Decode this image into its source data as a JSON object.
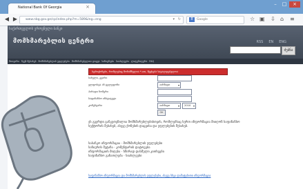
{
  "browser": {
    "tab_title": "National Bank Of Georgia",
    "tab_close": "×",
    "address": "www.nbg.gov.ge/cp/index.php?m=589&lng=eng",
    "search_placeholder": "Google",
    "icons": [
      "back-icon",
      "forward-icon",
      "refresh-icon",
      "star-icon",
      "bookmark-icon",
      "download-icon",
      "home-icon",
      "menu-icon"
    ],
    "window_controls": [
      "–",
      "□",
      "×"
    ]
  },
  "site": {
    "header_small": "საქართველოს ეროვნული ბანკი",
    "header_main": "მომხმარებლის ცენტრი",
    "header_links": [
      "RSS",
      "EN",
      "ENG"
    ],
    "search_button": "ძებნა",
    "nav": [
      "მთავარი",
      "ჩვენ შესახებ",
      "მომხმარებლის უფლებები",
      "მომხმარებელთა დაცვა",
      "საჩივრები",
      "სიახლეები",
      "ლიტერატურა",
      "FAQ"
    ],
    "alert": "სტრიქონები, რომლებიც მონიშნულია *-ით, შევსება სავალდებულოა"
  },
  "form": {
    "fields": [
      {
        "label": "სახელი, გვარი",
        "type": "input"
      },
      {
        "label": "ელფოსტა ან ტელეფონი",
        "type": "select",
        "value": "აირჩიეთ"
      },
      {
        "label": "პირადი ნომერი",
        "type": "input"
      },
      {
        "label": "საფინანსო ინსტიტუტი",
        "type": "input"
      },
      {
        "label": "კომენტარი",
        "type": "select",
        "value": "აირჩიეთ",
        "extra": "2010"
      }
    ],
    "submit": "OK"
  },
  "paragraphs": [
    "ეს გვერდი განკუთვნილია მომხმარებლებისთვის, რომლებსაც სურთ ინფორმაცია მიიღონ საფინანსო სექტორის შესახებ, ასევე ქონების დაცვისა და უფლებების შესახებ.",
    "საბანკო ინფორმაცია · მომხმარებლის უფლებები\nსაჩივრის შეტანა · კომენტარის დატოვება\nინფორმაციის მიღება · ხშირად დასმული კითხვები\nსაფინანსო განათლება · სიახლეები"
  ],
  "footer_link": "საფინანსო ინფორმაცია და მომხმარებლის უფლებები, ასევე სხვა დამატებითი ინფორმაცია"
}
